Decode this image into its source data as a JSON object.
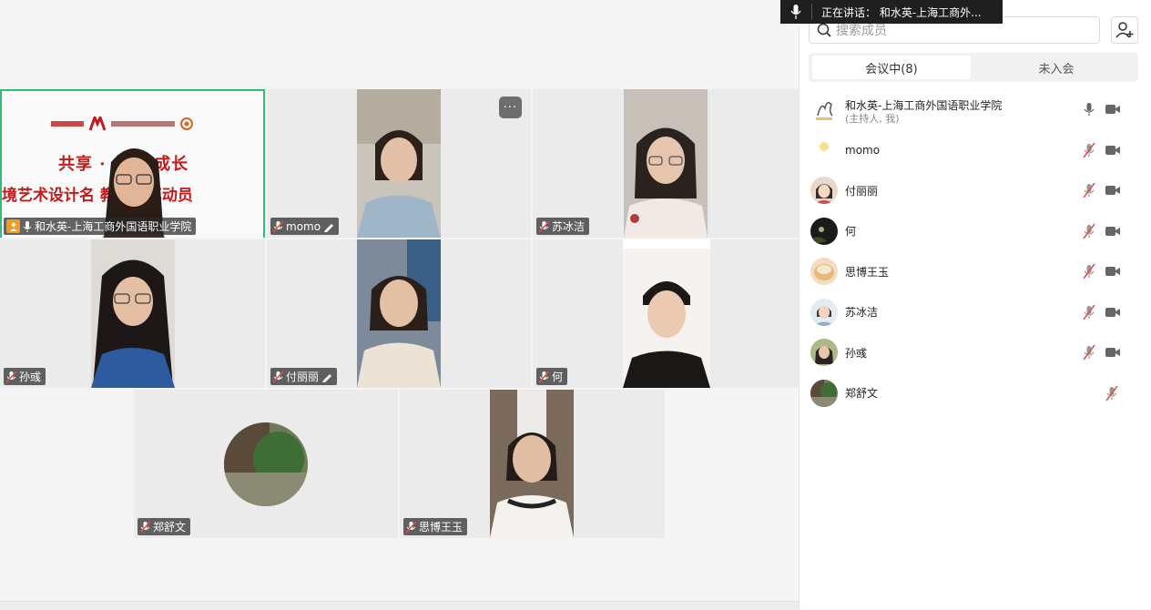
{
  "speaking_indicator": {
    "label": "正在讲话：",
    "speaker": "和水英-上海工商外..."
  },
  "search": {
    "placeholder": "搜索成员"
  },
  "tabs": [
    {
      "label": "会议中(8)",
      "active": true
    },
    {
      "label": "未入会",
      "active": false
    }
  ],
  "members": [
    {
      "name": "和水英-上海工商外国语职业学院",
      "role": "(主持人, 我)",
      "mic": "on",
      "camera": true
    },
    {
      "name": "momo",
      "mic": "muted",
      "camera": true
    },
    {
      "name": "付丽丽",
      "mic": "muted",
      "camera": true
    },
    {
      "name": "何",
      "mic": "muted",
      "camera": true
    },
    {
      "name": "思博王玉",
      "mic": "muted",
      "camera": true
    },
    {
      "name": "苏冰洁",
      "mic": "muted",
      "camera": true
    },
    {
      "name": "孙彧",
      "mic": "muted",
      "camera": true
    },
    {
      "name": "郑舒文",
      "mic": "muted",
      "camera": false
    }
  ],
  "tiles": {
    "host": {
      "name": "和水英-上海工商外国语职业学院"
    },
    "momo": {
      "name": "momo"
    },
    "subingjie": {
      "name": "苏冰洁"
    },
    "sunyu": {
      "name": "孙彧"
    },
    "fulili": {
      "name": "付丽丽"
    },
    "he": {
      "name": "何"
    },
    "zhengshuwen": {
      "name": "郑舒文"
    },
    "sibowangyu": {
      "name": "思博王玉"
    }
  },
  "slide": {
    "title_line1": "共享 · 共 共成长",
    "title_line2": "境艺术设计名 教研分享动员"
  },
  "colors": {
    "active_speaker_border": "#2fbe7a",
    "host_badge": "#f29b1d",
    "muted_mic": "#e0504a",
    "slide_red": "#c21b1b"
  }
}
